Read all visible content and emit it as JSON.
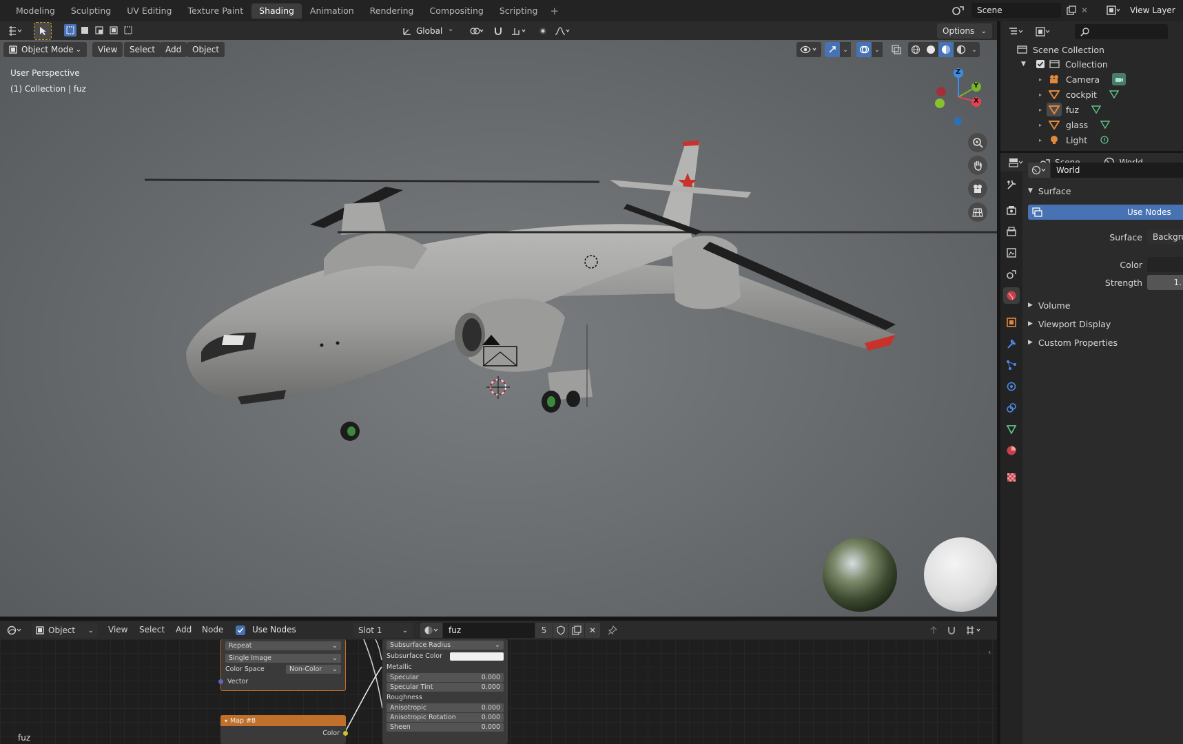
{
  "topbar": {
    "tabs": [
      "Modeling",
      "Sculpting",
      "UV Editing",
      "Texture Paint",
      "Shading",
      "Animation",
      "Rendering",
      "Compositing",
      "Scripting"
    ],
    "active_tab": "Shading",
    "scene_name": "Scene",
    "view_layer": "View Layer"
  },
  "viewport": {
    "mode": "Object Mode",
    "menus": [
      "View",
      "Select",
      "Add",
      "Object"
    ],
    "transform_orientation": "Global",
    "options_label": "Options",
    "info_perspective": "User Perspective",
    "info_collection": "(1) Collection | fuz",
    "gizmo_labels": {
      "z": "Z",
      "y": "Y",
      "x": "X"
    }
  },
  "node_editor": {
    "type": "Object",
    "menus": [
      "View",
      "Select",
      "Add",
      "Node"
    ],
    "use_nodes_label": "Use Nodes",
    "use_nodes_checked": true,
    "slot": "Slot 1",
    "material_name": "fuz",
    "user_count": "5",
    "corner_label": "fuz",
    "image_node": {
      "rows": [
        "Repeat",
        "Single Image"
      ],
      "color_space_label": "Color Space",
      "color_space_value": "Non-Color",
      "vector_label": "Vector"
    },
    "map_node": {
      "title": "Map #8",
      "output": "Color"
    },
    "bsdf_node": {
      "subsurface_radius": "Subsurface Radius",
      "subsurface_color": "Subsurface Color",
      "metallic": "Metallic",
      "fields": [
        {
          "label": "Specular",
          "value": "0.000"
        },
        {
          "label": "Specular Tint",
          "value": "0.000"
        }
      ],
      "roughness": "Roughness",
      "fields2": [
        {
          "label": "Anisotropic",
          "value": "0.000"
        },
        {
          "label": "Anisotropic Rotation",
          "value": "0.000"
        },
        {
          "label": "Sheen",
          "value": "0.000"
        }
      ]
    }
  },
  "outliner": {
    "root": "Scene Collection",
    "collection": "Collection",
    "items": [
      {
        "name": "Camera",
        "icon": "camera-icon"
      },
      {
        "name": "cockpit",
        "icon": "mesh-icon"
      },
      {
        "name": "fuz",
        "icon": "mesh-icon"
      },
      {
        "name": "glass",
        "icon": "mesh-icon"
      },
      {
        "name": "Light",
        "icon": "light-icon"
      }
    ]
  },
  "properties": {
    "breadcrumb_scene": "Scene",
    "breadcrumb_world": "World",
    "world_name": "World",
    "surface_panel": "Surface",
    "use_nodes_button": "Use Nodes",
    "surface_label": "Surface",
    "surface_value": "Backgrou",
    "color_label": "Color",
    "strength_label": "Strength",
    "strength_value": "1.",
    "panels": [
      "Volume",
      "Viewport Display",
      "Custom Properties"
    ]
  },
  "colors": {
    "accent": "#4772b3",
    "active_tab_bg": "#3d3d3d",
    "node_orange": "#c0702a"
  }
}
